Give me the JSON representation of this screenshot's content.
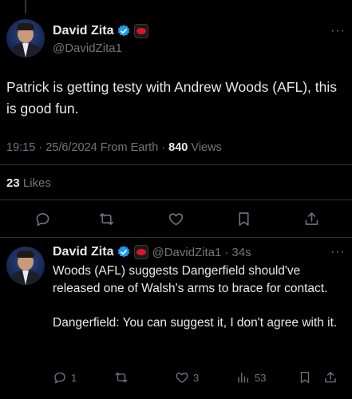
{
  "main_tweet": {
    "author_name": "David Zita",
    "handle": "@DavidZita1",
    "text": "Patrick is getting testy with Andrew Woods (AFL), this is good fun.",
    "time": "19:15",
    "date": "25/6/2024",
    "source": "From Earth",
    "views_count": "840",
    "views_label": "Views",
    "likes_count": "23",
    "likes_label": "Likes",
    "more_label": "···"
  },
  "reply": {
    "author_name": "David Zita",
    "handle": "@DavidZita1",
    "time_ago": "34s",
    "paragraph1": "Woods (AFL) suggests Dangerfield should've released one of Walsh's arms to brace for contact.",
    "paragraph2": "Dangerfield: You can suggest it, I don't agree with it.",
    "reply_count": "1",
    "retweet_count": "",
    "like_count": "3",
    "views_count": "53",
    "more_label": "···"
  },
  "separators": {
    "dot": "·"
  },
  "colors": {
    "background": "#000000",
    "text": "#e7e9ea",
    "muted": "#71767b",
    "verified": "#1d9bf0",
    "divider": "#2f3336"
  }
}
